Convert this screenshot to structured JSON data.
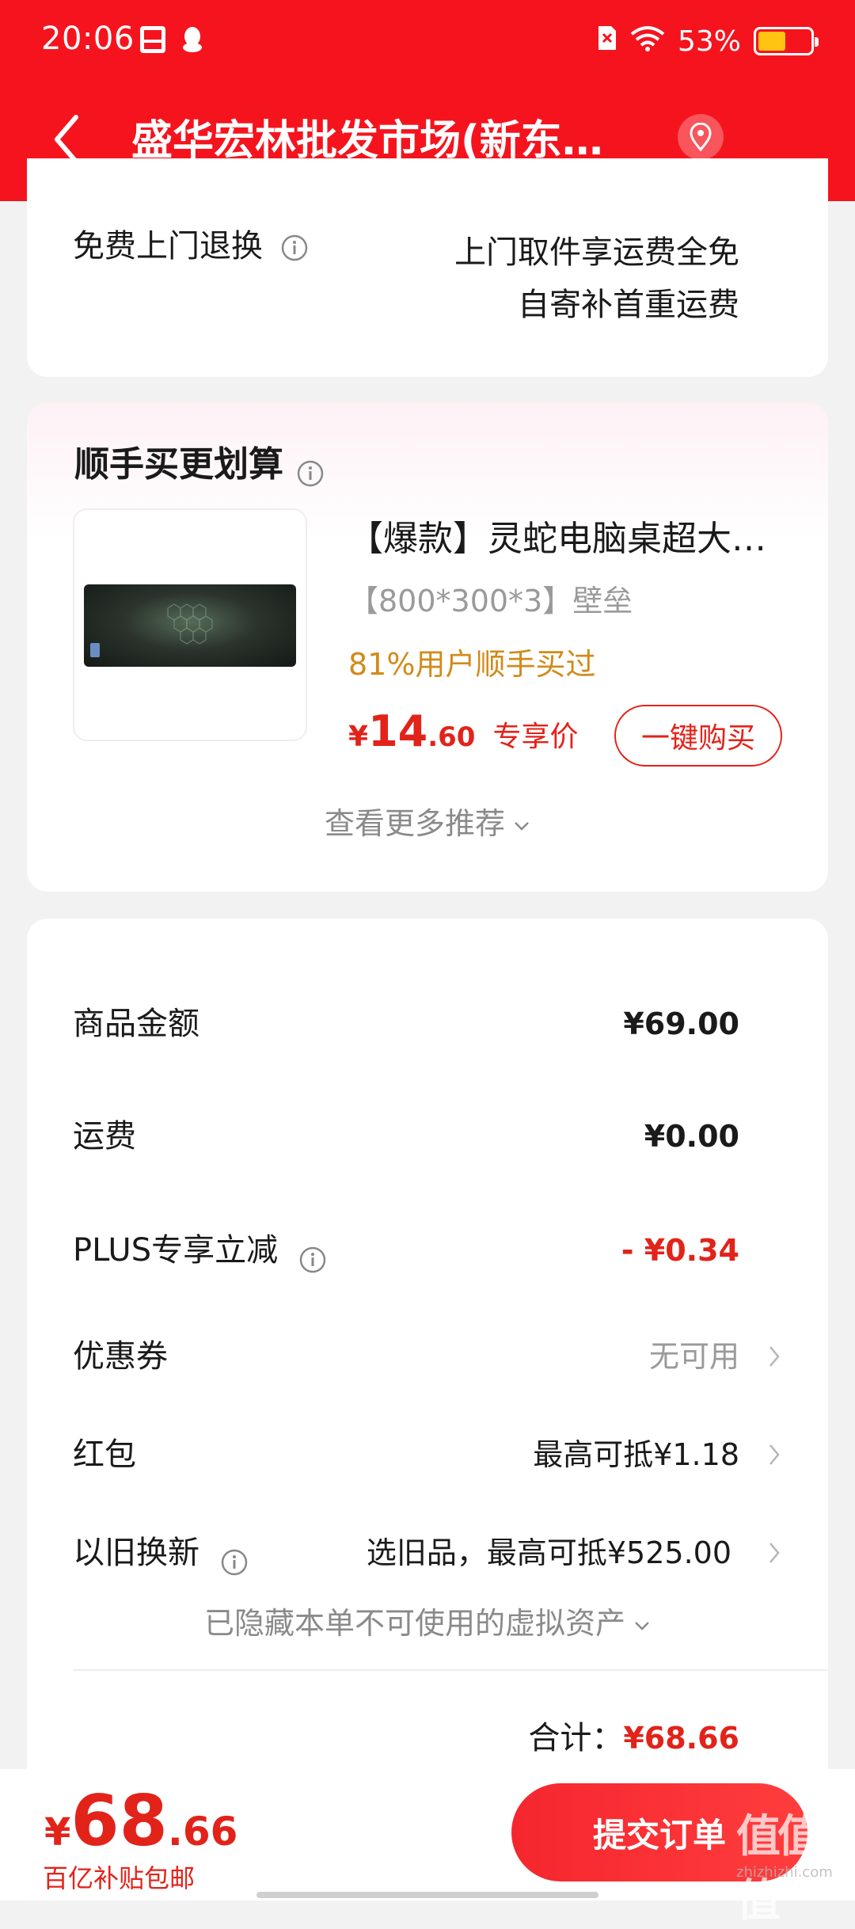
{
  "status_bar": {
    "time": "20:06",
    "battery": "53%",
    "battery_level": 0.53
  },
  "header": {
    "title": "盛华宏林批发市场(新东…"
  },
  "return_service": {
    "label": "免费上门退换",
    "line1": "上门取件享运费全免",
    "line2": "自寄补首重运费"
  },
  "recommend": {
    "title": "顺手买更划算",
    "product": {
      "name": "【爆款】灵蛇电脑桌超大…",
      "spec": "【800*300*3】壁垒",
      "bought": "81%用户顺手买过",
      "price_symbol": "¥",
      "price_int": "14",
      "price_dec": ".60",
      "price_note": "专享价",
      "buy_label": "一键购买"
    },
    "more": "查看更多推荐"
  },
  "summary": {
    "rows": [
      {
        "label": "商品金额",
        "value": "¥69.00"
      },
      {
        "label": "运费",
        "value": "¥0.00"
      },
      {
        "label": "PLUS专享立减",
        "value": "- ¥0.34"
      },
      {
        "label": "优惠券",
        "value": "无可用"
      },
      {
        "label": "红包",
        "value": "最高可抵¥1.18"
      },
      {
        "label": "以旧换新",
        "value": "选旧品，最高可抵¥525.00"
      }
    ],
    "hidden_assets": "已隐藏本单不可使用的虚拟资产",
    "total_label": "合计：",
    "total_value": "¥68.66"
  },
  "bottom": {
    "price_symbol": "¥",
    "price_int": "68",
    "price_dec": ".66",
    "subtitle": "百亿补贴包邮",
    "submit_label": "提交订单",
    "watermark": "值值值",
    "watermark_sub": "zhizhizhi.com"
  },
  "colors": {
    "brand_red": "#f5141e",
    "price_red": "#e2231a",
    "orange": "#d28a1a",
    "battery": "#ffc412"
  }
}
